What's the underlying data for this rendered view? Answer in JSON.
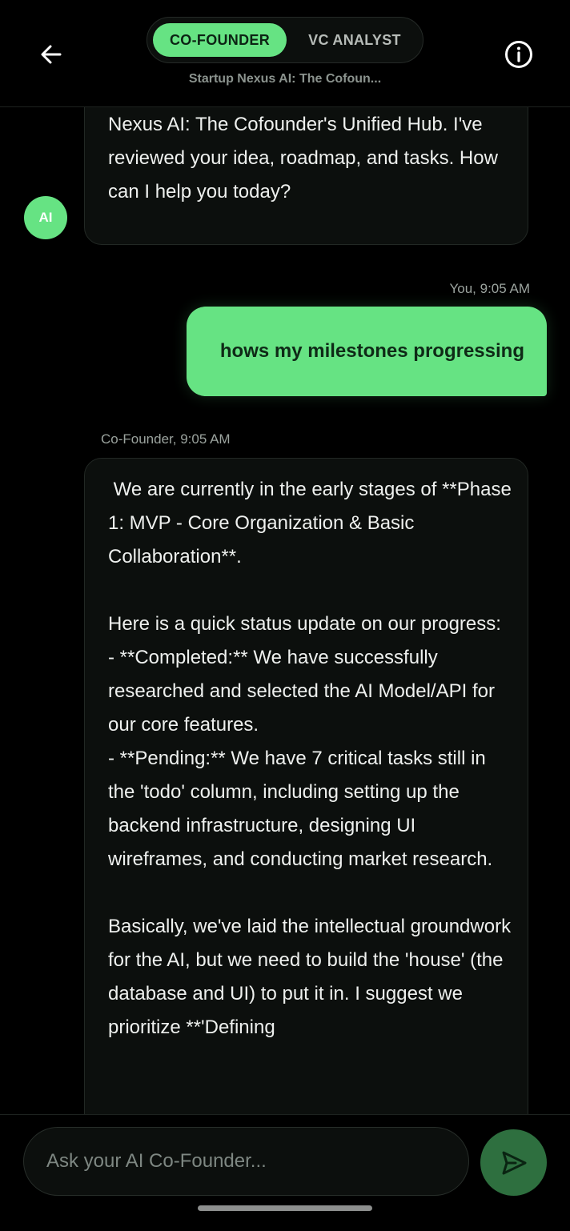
{
  "header": {
    "tabs": [
      {
        "label": "CO-FOUNDER",
        "active": true
      },
      {
        "label": "VC ANALYST",
        "active": false
      }
    ],
    "subtitle": "Startup Nexus AI: The Cofoun..."
  },
  "icons": {
    "back": "back-arrow-icon",
    "info": "info-icon",
    "send": "send-icon"
  },
  "chat": {
    "avatar_label": "AI",
    "messages": [
      {
        "sender": "ai",
        "text": "Hello! I'm your AI Co-Founder for Startup Nexus AI: The Cofounder's Unified Hub. I've reviewed your idea, roadmap, and tasks. How can I help you today?"
      },
      {
        "sender": "user",
        "meta": "You, 9:05 AM",
        "text": "hows my milestones progressing"
      },
      {
        "sender": "ai",
        "meta": "Co-Founder, 9:05 AM",
        "text": " We are currently in the early stages of **Phase 1: MVP - Core Organization & Basic Collaboration**.\n\nHere is a quick status update on our progress:\n- **Completed:** We have successfully researched and selected the AI Model/API for our core features.\n- **Pending:** We have 7 critical tasks still in the 'todo' column, including setting up the backend infrastructure, designing UI wireframes, and conducting market research.\n\nBasically, we've laid the intellectual groundwork for the AI, but we need to build the 'house' (the database and UI) to put it in. I suggest we prioritize **'Defining"
      }
    ]
  },
  "input": {
    "placeholder": "Ask your AI Co-Founder...",
    "value": ""
  },
  "colors": {
    "accent": "#66e383",
    "send_button": "#2e6f3f",
    "background": "#000000",
    "bubble_bg": "#0c0f0d"
  }
}
